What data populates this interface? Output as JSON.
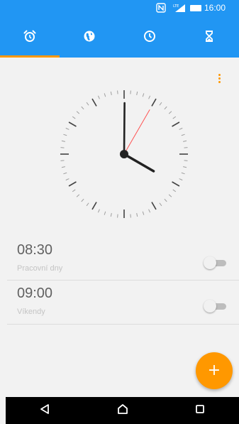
{
  "status_bar": {
    "nfc_icon": "nfc-icon",
    "signal_label": "LTE",
    "battery_icon": "battery-icon",
    "time": "16:00"
  },
  "tabs": [
    {
      "name": "alarm",
      "icon": "alarm-clock-icon",
      "active": true
    },
    {
      "name": "world-clock",
      "icon": "globe-icon",
      "active": false
    },
    {
      "name": "stopwatch",
      "icon": "clock-icon",
      "active": false
    },
    {
      "name": "timer",
      "icon": "hourglass-icon",
      "active": false
    }
  ],
  "overflow_menu_icon": "more-vert-icon",
  "analog_clock": {
    "hour": 4,
    "minute": 0,
    "second": 5
  },
  "alarms": [
    {
      "time": "08:30",
      "label": "Pracovní dny",
      "enabled": false
    },
    {
      "time": "09:00",
      "label": "Víkendy",
      "enabled": false
    }
  ],
  "fab": {
    "label": "+",
    "icon": "add-icon"
  },
  "nav_bar": [
    {
      "name": "back",
      "icon": "back-triangle-icon"
    },
    {
      "name": "home",
      "icon": "home-icon"
    },
    {
      "name": "recents",
      "icon": "recents-square-icon"
    }
  ],
  "colors": {
    "primary": "#2196f3",
    "accent": "#ff9800",
    "background": "#f2f2f2",
    "second_hand": "#ff5252"
  }
}
